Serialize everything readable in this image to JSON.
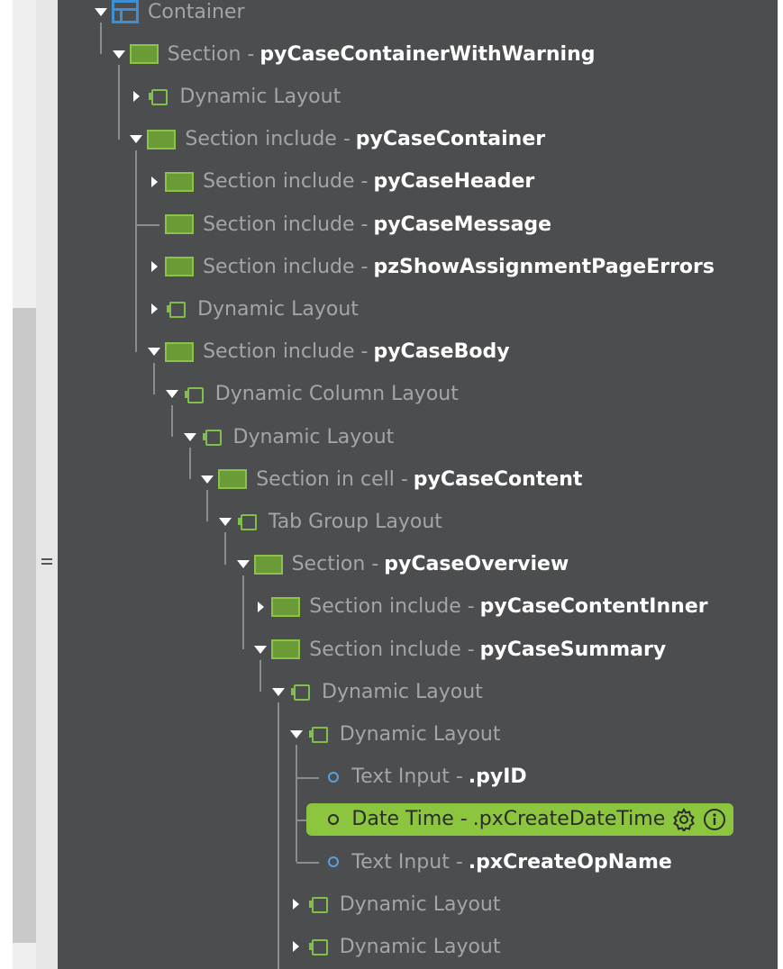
{
  "tree": {
    "nodes": [
      {
        "toggle": "down",
        "icon": "container-icon",
        "label": "Container",
        "name": ""
      },
      {
        "toggle": "down",
        "icon": "section-icon",
        "label": "Section -",
        "name": "pyCaseContainerWithWarning"
      },
      {
        "toggle": "right",
        "icon": "layout-icon",
        "label": "Dynamic Layout",
        "name": ""
      },
      {
        "toggle": "down",
        "icon": "section-icon",
        "label": "Section include -",
        "name": "pyCaseContainer"
      },
      {
        "toggle": "right",
        "icon": "section-icon",
        "label": "Section include -",
        "name": "pyCaseHeader"
      },
      {
        "toggle": "none",
        "icon": "section-icon",
        "label": "Section include -",
        "name": "pyCaseMessage"
      },
      {
        "toggle": "right",
        "icon": "section-icon",
        "label": "Section include -",
        "name": "pzShowAssignmentPageErrors"
      },
      {
        "toggle": "right",
        "icon": "layout-icon",
        "label": "Dynamic Layout",
        "name": ""
      },
      {
        "toggle": "down",
        "icon": "section-icon",
        "label": "Section include -",
        "name": "pyCaseBody"
      },
      {
        "toggle": "down",
        "icon": "layout-icon",
        "label": "Dynamic Column Layout",
        "name": ""
      },
      {
        "toggle": "down",
        "icon": "layout-icon",
        "label": "Dynamic Layout",
        "name": ""
      },
      {
        "toggle": "down",
        "icon": "section-icon",
        "label": "Section in cell -",
        "name": "pyCaseContent"
      },
      {
        "toggle": "down",
        "icon": "layout-icon",
        "label": "Tab Group Layout",
        "name": ""
      },
      {
        "toggle": "down",
        "icon": "section-icon",
        "label": "Section -",
        "name": "pyCaseOverview"
      },
      {
        "toggle": "right",
        "icon": "section-icon",
        "label": "Section include -",
        "name": "pyCaseContentInner"
      },
      {
        "toggle": "down",
        "icon": "section-icon",
        "label": "Section include -",
        "name": "pyCaseSummary"
      },
      {
        "toggle": "down",
        "icon": "layout-icon",
        "label": "Dynamic Layout",
        "name": ""
      },
      {
        "toggle": "down",
        "icon": "layout-icon",
        "label": "Dynamic Layout",
        "name": ""
      },
      {
        "toggle": "none",
        "icon": "field-icon",
        "label": "Text Input -",
        "name": ".pyID"
      },
      {
        "toggle": "none",
        "icon": "field-icon",
        "label": "Date Time -",
        "name": ".pxCreateDateTime",
        "selected": true
      },
      {
        "toggle": "none",
        "icon": "field-icon",
        "label": "Text Input -",
        "name": ".pxCreateOpName"
      },
      {
        "toggle": "right",
        "icon": "layout-icon",
        "label": "Dynamic Layout",
        "name": ""
      },
      {
        "toggle": "right",
        "icon": "layout-icon",
        "label": "Dynamic Layout",
        "name": ""
      }
    ],
    "selected_actions": [
      "gear-icon",
      "info-icon"
    ]
  },
  "colors": {
    "panel_bg": "#4b4d4f",
    "selected_bg": "#8cc63f",
    "section_green": "#6b9b37",
    "container_blue": "#3d8fd6"
  }
}
